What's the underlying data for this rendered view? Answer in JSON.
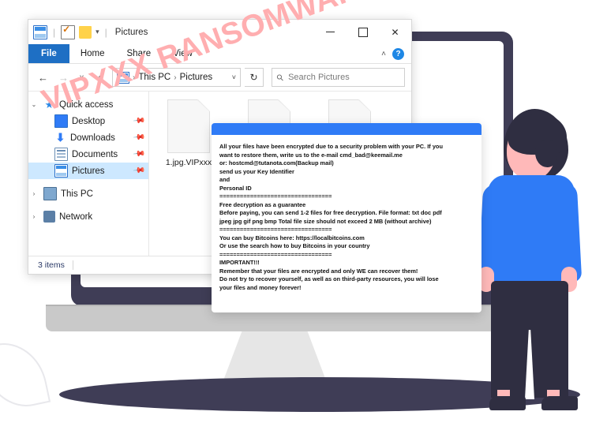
{
  "illustration": {
    "monitor_label": "desktop-monitor",
    "person_label": "standing-person",
    "colors": {
      "bezel": "#3f3d56",
      "chin": "#c9c9c9",
      "shadow": "#3f3d56",
      "shirt": "#2f7bf6",
      "skin": "#ffb9b9",
      "hair": "#2f2e41"
    }
  },
  "watermark": {
    "text": "VIPXXX RANSOMWARE",
    "color": "#ffaeb0"
  },
  "explorer": {
    "title": "Pictures",
    "quick_access_toolbar": {
      "pictures_icon": "pictures-icon",
      "properties_icon": "properties-icon",
      "new_folder_icon": "new-folder-icon",
      "customize_caret": "▾"
    },
    "window_controls": {
      "minimize": "─",
      "maximize": "□",
      "close": "✕"
    },
    "ribbon_tabs": [
      {
        "label": "File",
        "active": true
      },
      {
        "label": "Home",
        "active": false
      },
      {
        "label": "Share",
        "active": false
      },
      {
        "label": "View",
        "active": false
      }
    ],
    "ribbon_right": {
      "collapse_caret": "˄",
      "help_label": "?"
    },
    "navigation": {
      "back": "←",
      "forward": "→",
      "recent": "˅",
      "up": "↑",
      "refresh": "↻",
      "address_caret": "˅",
      "breadcrumbs": [
        "This PC",
        "Pictures"
      ],
      "breadcrumb_separator": "›"
    },
    "search": {
      "placeholder": "Search Pictures",
      "value": "",
      "icon": "search-icon"
    },
    "nav_pane": [
      {
        "label": "Quick access",
        "expander": "⌄",
        "icon": "star-icon",
        "pinned": false,
        "selected": false,
        "level": 0
      },
      {
        "label": "Desktop",
        "expander": "",
        "icon": "desktop-icon",
        "pinned": true,
        "selected": false,
        "level": 1
      },
      {
        "label": "Downloads",
        "expander": "",
        "icon": "download-icon",
        "pinned": true,
        "selected": false,
        "level": 1
      },
      {
        "label": "Documents",
        "expander": "",
        "icon": "documents-icon",
        "pinned": true,
        "selected": false,
        "level": 1
      },
      {
        "label": "Pictures",
        "expander": "",
        "icon": "pictures-icon",
        "pinned": true,
        "selected": true,
        "level": 1
      },
      {
        "label": "This PC",
        "expander": "›",
        "icon": "this-pc-icon",
        "pinned": false,
        "selected": false,
        "level": 0
      },
      {
        "label": "Network",
        "expander": "›",
        "icon": "network-icon",
        "pinned": false,
        "selected": false,
        "level": 0
      }
    ],
    "files": [
      {
        "name": "1.jpg.VIPxxx"
      },
      {
        "name": ""
      },
      {
        "name": ""
      }
    ],
    "status": {
      "item_count": "3 items"
    }
  },
  "ransom_note": {
    "header_color": "#2f7bf6",
    "lines": [
      "All your files have been encrypted due to a security problem with your PC. If you",
      "want to restore them, write us to the e-mail cmd_bad@keemail.me",
      "or: hostcmd@tutanota.com(Backup mail)",
      "send us your Key Identifier",
      "and",
      "Personal ID",
      "=================================",
      "Free decryption as a guarantee",
      "Before paying, you can send 1-2 files for free decryption. File format: txt doc pdf",
      "jpeg jpg gif png bmp Total file size should not exceed 2 MB (without archive)",
      "=================================",
      "You can buy Bitcoins here: https://localbitcoins.com",
      "Or use the search how to buy Bitcoins in your country",
      "=================================",
      "IMPORTANT!!!",
      "Remember that your files are encrypted and only WE can recover them!",
      "Do not try to recover yourself, as well as on third-party resources, you will lose",
      "your files and money forever!"
    ],
    "text": "All your files have been encrypted due to a security problem with your PC. If you\nwant to restore them, write us to the e-mail cmd_bad@keemail.me\nor: hostcmd@tutanota.com(Backup mail)\nsend us your Key Identifier\nand\nPersonal ID\n=================================\nFree decryption as a guarantee\nBefore paying, you can send 1-2 files for free decryption. File format: txt doc pdf\njpeg jpg gif png bmp Total file size should not exceed 2 MB (without archive)\n=================================\nYou can buy Bitcoins here: https://localbitcoins.com\nOr use the search how to buy Bitcoins in your country\n=================================\nIMPORTANT!!!\nRemember that your files are encrypted and only WE can recover them!\nDo not try to recover yourself, as well as on third-party resources, you will lose\nyour files and money forever!"
  }
}
